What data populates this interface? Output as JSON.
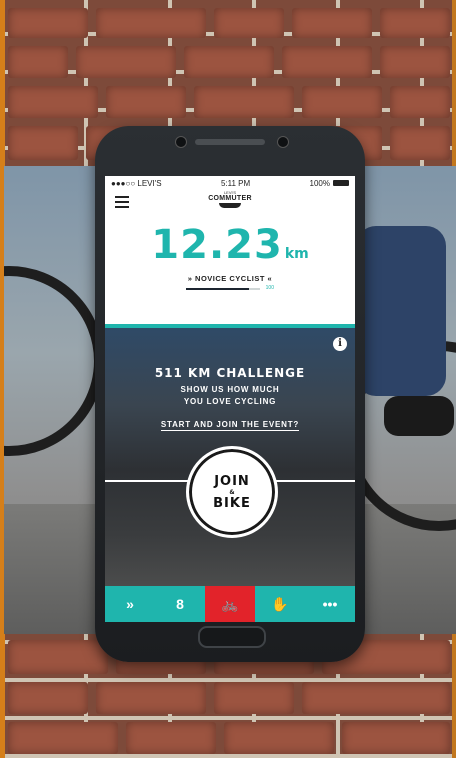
{
  "phone": {
    "status_bar": {
      "carrier": "●●●○○ LEVI'S",
      "time": "5:11 PM",
      "battery": "100%"
    },
    "app_header": {
      "logo_small": "LEVI'S",
      "logo_word": "COMMUTER"
    },
    "distance": {
      "value": "12.23",
      "unit": "km"
    },
    "level": {
      "label": "» NOVICE CYCLIST «",
      "progress_label": "100",
      "progress_fraction": 0.85
    },
    "event": {
      "title": "511 KM CHALLENGE",
      "subtitle_line1": "SHOW US HOW MUCH",
      "subtitle_line2": "YOU LOVE CYCLING",
      "link": "START AND JOIN THE EVENT?",
      "join_line1": "JOIN",
      "join_line2": "&",
      "join_line3": "BIKE"
    },
    "tabs": [
      {
        "icon": "fast-forward-icon",
        "glyph": "»"
      },
      {
        "icon": "medal-icon",
        "glyph": "8"
      },
      {
        "icon": "bicycle-icon",
        "glyph": "🚲",
        "active": true
      },
      {
        "icon": "hand-icon",
        "glyph": "✋"
      },
      {
        "icon": "more-icon",
        "glyph": "•••"
      }
    ]
  },
  "colors": {
    "accent": "#1fb5ad",
    "active_tab": "#e2232a"
  }
}
